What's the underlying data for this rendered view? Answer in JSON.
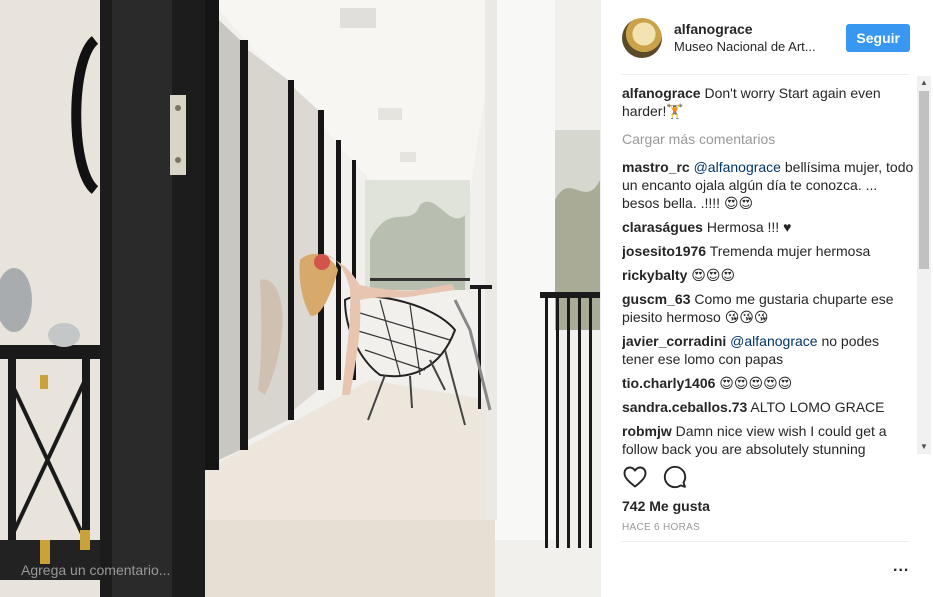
{
  "post": {
    "username": "alfanograce",
    "location": "Museo Nacional de Art...",
    "follow_label": "Seguir",
    "caption_user": "alfanograce",
    "caption_text": "Don't worry Start again even harder!🏋",
    "load_more": "Cargar más comentarios",
    "likes": "742 Me gusta",
    "timestamp": "HACE 6 HORAS",
    "add_comment_placeholder": "Agrega un comentario...",
    "more_options": "..."
  },
  "comments": [
    {
      "user": "mastro_rc",
      "mention": "@alfanograce",
      "text": " bellísima mujer, todo un encanto ojala algún día te conozca. ... besos bella. .!!!! 😍😍"
    },
    {
      "user": "claraságues",
      "mention": "",
      "text": "Hermosa !!! ♥"
    },
    {
      "user": "josesito1976",
      "mention": "",
      "text": "Tremenda mujer hermosa"
    },
    {
      "user": "rickybalty",
      "mention": "",
      "text": "😍😍😍"
    },
    {
      "user": "guscm_63",
      "mention": "",
      "text": "Como me gustaria chuparte ese piesito hermoso 😘😘😘"
    },
    {
      "user": "javier_corradini",
      "mention": "@alfanograce",
      "text": " no podes tener ese lomo con papas"
    },
    {
      "user": "tio.charly1406",
      "mention": "",
      "text": "😍😍😍😍😍"
    },
    {
      "user": "sandra.ceballos.73",
      "mention": "",
      "text": "ALTO LOMO GRACE"
    },
    {
      "user": "robmjw",
      "mention": "",
      "text": "Damn nice view wish I could get a follow back you are absolutely stunning"
    }
  ],
  "icons": {
    "heart": "heart-icon",
    "comment": "comment-icon"
  },
  "colors": {
    "follow_button": "#3897f0",
    "mention": "#003569",
    "muted": "#999999"
  }
}
